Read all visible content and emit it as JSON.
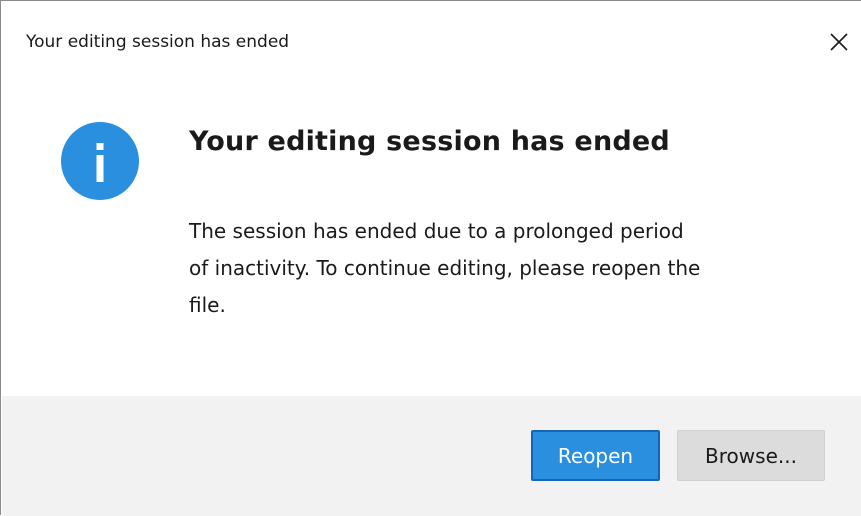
{
  "window": {
    "title": "Your editing session has ended",
    "close_icon": "close-icon"
  },
  "dialog": {
    "icon": "info-icon",
    "icon_color": "#2b8fe0",
    "heading": "Your editing session has ended",
    "message_lines": [
      "The session has ended due to a prolonged period",
      "of inactivity. To continue editing, please reopen the",
      "file."
    ]
  },
  "buttons": {
    "primary_label": "Reopen",
    "secondary_label": "Browse..."
  },
  "colors": {
    "accent": "#2b8fe0",
    "footer_bg": "#f2f2f2"
  }
}
